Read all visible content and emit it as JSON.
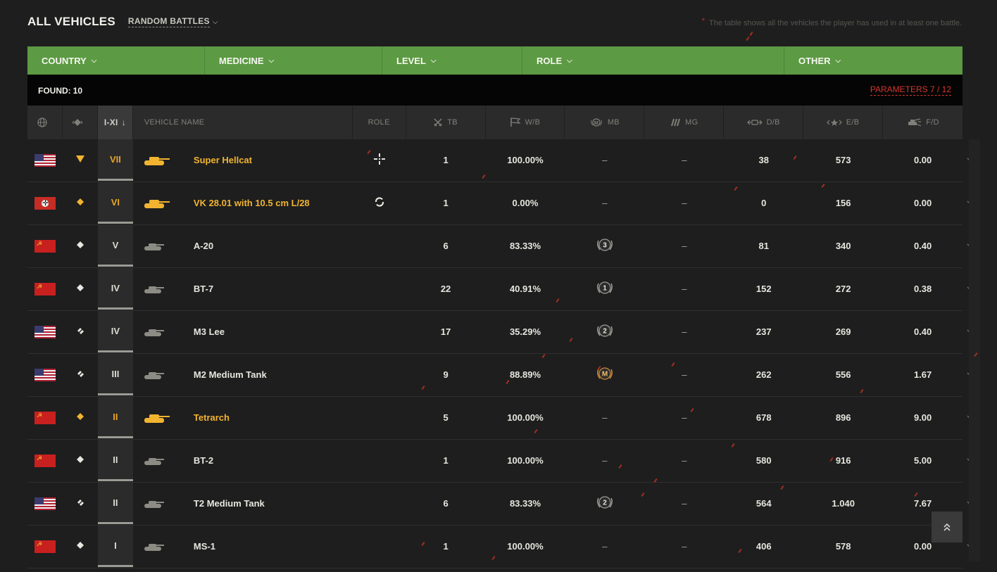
{
  "header": {
    "title": "ALL VEHICLES",
    "mode": "RANDOM BATTLES",
    "note_star": "*",
    "note": "The table shows all the vehicles the player has used in at least one battle."
  },
  "filters": [
    {
      "label": "COUNTRY"
    },
    {
      "label": "MEDICINE"
    },
    {
      "label": "LEVEL"
    },
    {
      "label": "ROLE"
    },
    {
      "label": "OTHER"
    }
  ],
  "found": {
    "label": "FOUND:",
    "count": "10",
    "parameters": "PARAMETERS 7 / 12"
  },
  "columns": {
    "tier": "I-XI",
    "tier_sort": "↓",
    "name": "VEHICLE NAME",
    "role": "ROLE",
    "tb": "TB",
    "wb": "W/B",
    "mb": "MB",
    "mg": "MG",
    "db": "D/B",
    "eb": "E/B",
    "fd": "F/D"
  },
  "colors": {
    "accent_green": "#5c9a44",
    "gold": "#f2b430",
    "params_red": "#d7352c"
  },
  "rows": [
    {
      "flag": "usa",
      "type_icon": "td-triangle-icon",
      "type_color": "#f2b430",
      "tier": "VII",
      "tank_color": "#f2b430",
      "name": "Super Hellcat",
      "premium": true,
      "role_icon": "crosshair-role-icon",
      "tb": "1",
      "wb": "100.00%",
      "mb": "–",
      "mb_badge": "",
      "mg": "–",
      "db": "38",
      "eb": "573",
      "fd": "0.00"
    },
    {
      "flag": "ger",
      "type_icon": "diamond-icon",
      "type_color": "#f2b430",
      "tier": "VI",
      "tank_color": "#f2b430",
      "name": "VK 28.01 with 10.5 cm L/28",
      "premium": true,
      "role_icon": "cycle-role-icon",
      "tb": "1",
      "wb": "0.00%",
      "mb": "–",
      "mb_badge": "",
      "mg": "–",
      "db": "0",
      "eb": "156",
      "fd": "0.00"
    },
    {
      "flag": "ussr",
      "type_icon": "diamond-icon",
      "type_color": "#e8e8e0",
      "tier": "V",
      "tank_color": "#8c8c84",
      "name": "A-20",
      "premium": false,
      "role_icon": "",
      "tb": "6",
      "wb": "83.33%",
      "mb": "",
      "mb_badge": "3",
      "mg": "–",
      "db": "81",
      "eb": "340",
      "fd": "0.40"
    },
    {
      "flag": "ussr",
      "type_icon": "diamond-icon",
      "type_color": "#e8e8e0",
      "tier": "IV",
      "tank_color": "#8c8c84",
      "name": "BT-7",
      "premium": false,
      "role_icon": "",
      "tb": "22",
      "wb": "40.91%",
      "mb": "",
      "mb_badge": "1",
      "mg": "–",
      "db": "152",
      "eb": "272",
      "fd": "0.38"
    },
    {
      "flag": "usa",
      "type_icon": "medium-icon",
      "type_color": "#e8e8e0",
      "tier": "IV",
      "tank_color": "#8c8c84",
      "name": "M3 Lee",
      "premium": false,
      "role_icon": "",
      "tb": "17",
      "wb": "35.29%",
      "mb": "",
      "mb_badge": "2",
      "mg": "–",
      "db": "237",
      "eb": "269",
      "fd": "0.40"
    },
    {
      "flag": "usa",
      "type_icon": "medium-icon",
      "type_color": "#e8e8e0",
      "tier": "III",
      "tank_color": "#8c8c84",
      "name": "M2 Medium Tank",
      "premium": false,
      "role_icon": "",
      "tb": "9",
      "wb": "88.89%",
      "mb": "",
      "mb_badge": "M",
      "mg": "–",
      "db": "262",
      "eb": "556",
      "fd": "1.67"
    },
    {
      "flag": "ussr",
      "type_icon": "diamond-icon",
      "type_color": "#f2b430",
      "tier": "II",
      "tank_color": "#f2b430",
      "name": "Tetrarch",
      "premium": true,
      "role_icon": "",
      "tb": "5",
      "wb": "100.00%",
      "mb": "–",
      "mb_badge": "",
      "mg": "–",
      "db": "678",
      "eb": "896",
      "fd": "9.00"
    },
    {
      "flag": "ussr",
      "type_icon": "diamond-icon",
      "type_color": "#e8e8e0",
      "tier": "II",
      "tank_color": "#8c8c84",
      "name": "BT-2",
      "premium": false,
      "role_icon": "",
      "tb": "1",
      "wb": "100.00%",
      "mb": "–",
      "mb_badge": "",
      "mg": "–",
      "db": "580",
      "eb": "916",
      "fd": "5.00"
    },
    {
      "flag": "usa",
      "type_icon": "medium-icon",
      "type_color": "#e8e8e0",
      "tier": "II",
      "tank_color": "#8c8c84",
      "name": "T2 Medium Tank",
      "premium": false,
      "role_icon": "",
      "tb": "6",
      "wb": "83.33%",
      "mb": "",
      "mb_badge": "2",
      "mg": "–",
      "db": "564",
      "eb": "1.040",
      "fd": "7.67"
    },
    {
      "flag": "ussr",
      "type_icon": "diamond-icon",
      "type_color": "#e8e8e0",
      "tier": "I",
      "tank_color": "#8c8c84",
      "name": "MS-1",
      "premium": false,
      "role_icon": "",
      "tb": "1",
      "wb": "100.00%",
      "mb": "–",
      "mb_badge": "",
      "mg": "–",
      "db": "406",
      "eb": "578",
      "fd": "0.00"
    }
  ]
}
